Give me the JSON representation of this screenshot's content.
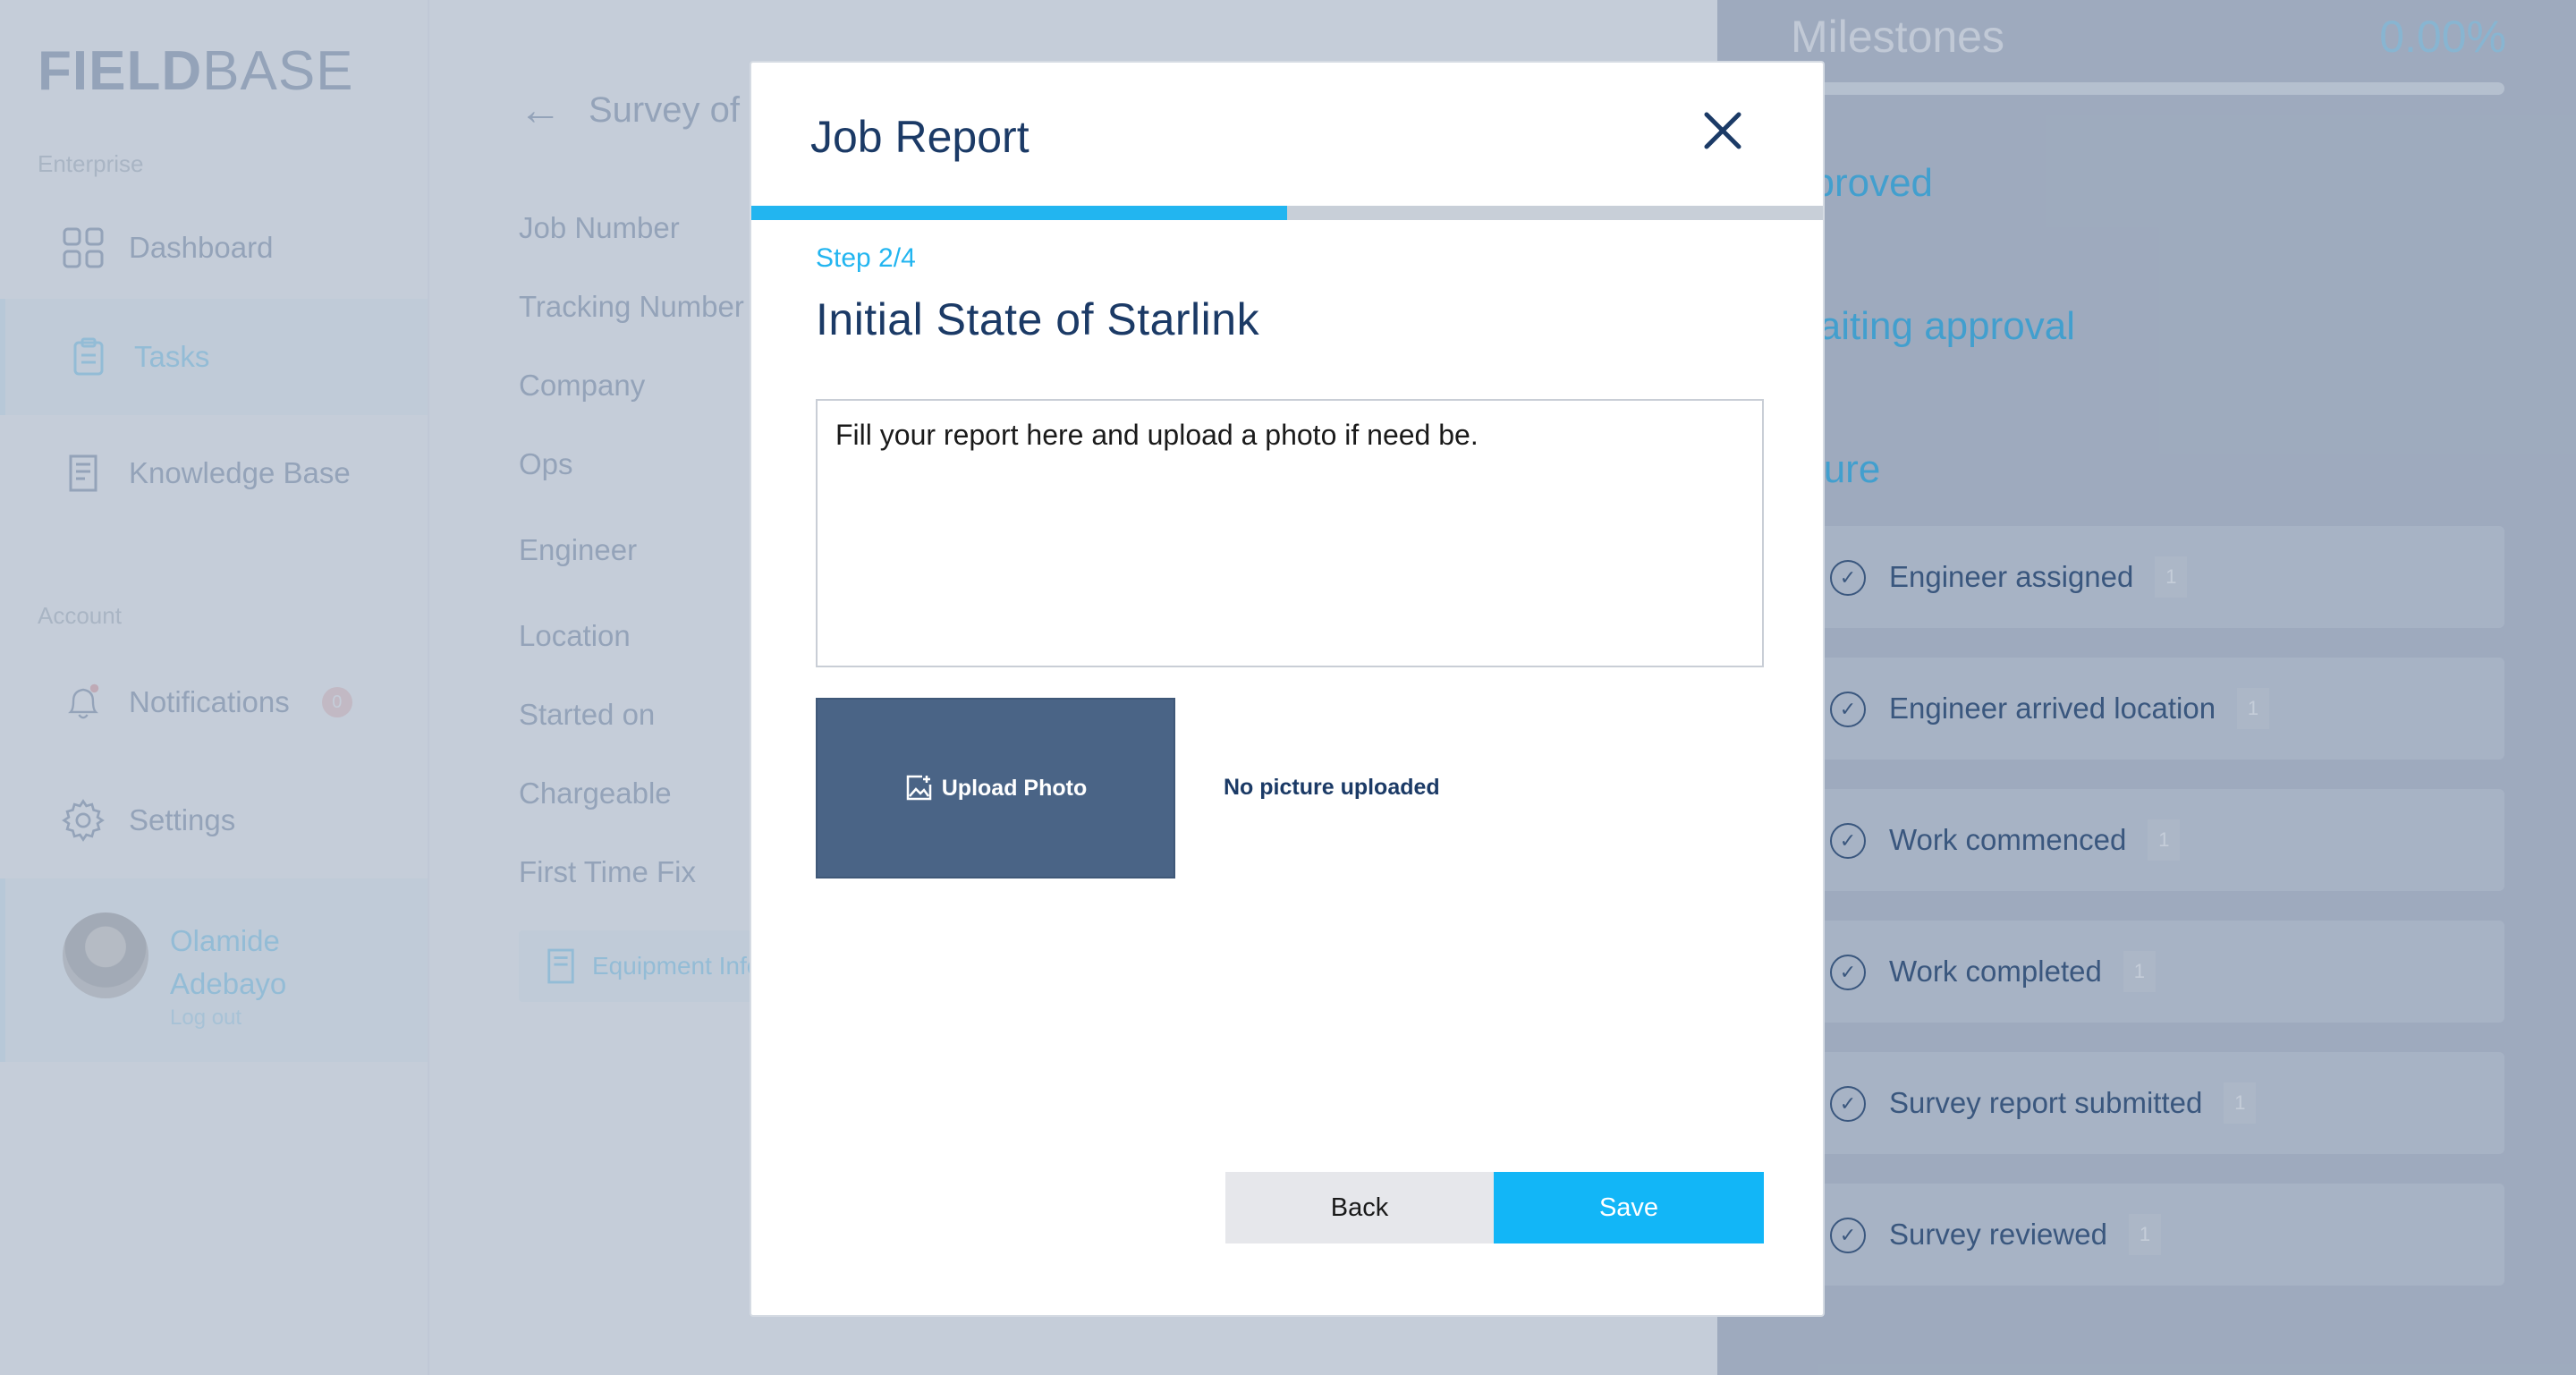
{
  "app": {
    "logo_a": "FIELD",
    "logo_b": "BASE"
  },
  "sidebar": {
    "section_enterprise": "Enterprise",
    "items": [
      {
        "label": "Dashboard",
        "icon": "grid-icon"
      },
      {
        "label": "Tasks",
        "icon": "clipboard-icon"
      },
      {
        "label": "Knowledge Base",
        "icon": "document-icon"
      }
    ],
    "section_account": "Account",
    "account_items": [
      {
        "label": "Notifications",
        "icon": "bell-icon",
        "badge": "0"
      },
      {
        "label": "Settings",
        "icon": "gear-icon"
      }
    ],
    "user": {
      "name": "Olamide Adebayo",
      "logout": "Log out"
    }
  },
  "content": {
    "back_title": "Survey of",
    "fields": [
      "Job Number",
      "Tracking Number",
      "Company",
      "Ops",
      "Engineer",
      "Location",
      "Started on",
      "Chargeable",
      "First Time Fix"
    ],
    "equipment_button": "Equipment Info"
  },
  "milestones": {
    "title": "Milestones",
    "percent": "0.00%",
    "progress_fraction": 0.0,
    "groups": [
      "pproved",
      "waiting approval",
      "uture"
    ],
    "items": [
      {
        "label": "Engineer assigned",
        "count": "1"
      },
      {
        "label": "Engineer arrived location",
        "count": "1"
      },
      {
        "label": "Work commenced",
        "count": "1"
      },
      {
        "label": "Work completed",
        "count": "1"
      },
      {
        "label": "Survey report submitted",
        "count": "1"
      },
      {
        "label": "Survey reviewed",
        "count": "1"
      }
    ]
  },
  "modal": {
    "title": "Job Report",
    "step": "Step 2/4",
    "step_progress": 0.5,
    "step_title": "Initial State of Starlink",
    "report_value": "Fill your report here and upload a photo if need be.",
    "upload_label": "Upload Photo",
    "no_picture": "No picture uploaded",
    "back_label": "Back",
    "save_label": "Save"
  },
  "colors": {
    "accent": "#12b6f7",
    "navy": "#1b3a66",
    "upload": "#4a6486"
  }
}
